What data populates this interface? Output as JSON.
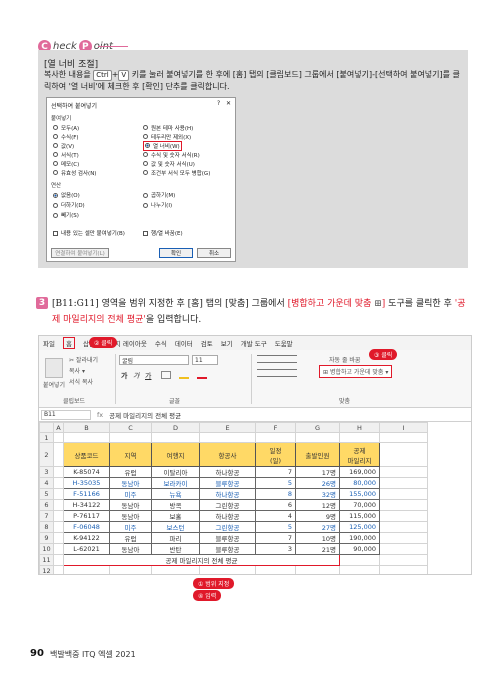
{
  "checkpoint": {
    "c": "C",
    "heck": "heck",
    "p": "P",
    "oint": "oint"
  },
  "box": {
    "title": "[열 너비 조절]",
    "text_1": "복사한 내용을 ",
    "key_ctrl": "Ctrl",
    "plus": "+",
    "key_v": "V",
    "text_2": " 키를 눌러 붙여넣기를 한 후에 [홈] 탭의 [클립보드] 그룹에서 [붙여넣기]-[선택하여 붙여넣기]를 클릭하여 '열 너비'에 체크한 후 [확인] 단추를 클릭합니다."
  },
  "dialog": {
    "title": "선택하여 붙여넣기",
    "help": "?",
    "close": "✕",
    "paste_label": "붙여넣기",
    "paste_left": [
      "모두(A)",
      "수식(F)",
      "값(V)",
      "서식(T)",
      "메모(C)",
      "유효성 검사(N)"
    ],
    "paste_right": [
      "원본 테마 사용(H)",
      "테두리만 제외(X)",
      "열 너비(W)",
      "수식 및 숫자 서식(R)",
      "값 및 숫자 서식(U)",
      "조건부 서식 모두 병합(G)"
    ],
    "op_label": "연산",
    "op_left": [
      "없음(O)",
      "더하기(D)",
      "빼기(S)"
    ],
    "op_right": [
      "곱하기(M)",
      "나누기(I)"
    ],
    "skip_blanks": "내용 있는 셀만 붙여넣기(B)",
    "transpose": "행/열 바꿈(E)",
    "paste_link": "연결하여 붙여넣기(L)",
    "ok": "확인",
    "cancel": "취소"
  },
  "step": {
    "num": "3",
    "text_1": "[B11:G11] 영역을 범위 지정한 후 [홈] 탭의 [맞춤] 그룹에서 ",
    "text_red": "[병합하고 가운데 맞춤",
    "icon": "⊞",
    "text_red2": "]",
    "text_2": " 도구를 클릭한 후 ",
    "text_red3": "'공제 마일리지의 전체 평균'",
    "text_3": "을 입력합니다."
  },
  "excel": {
    "menu": [
      "파일",
      "홈",
      "삽입",
      "페이지 레이아웃",
      "수식",
      "데이터",
      "검토",
      "보기",
      "개발 도구",
      "도움말"
    ],
    "callout_click2": "② 클릭",
    "callout_click3": "③ 클릭",
    "ribbon": {
      "cut": "✂ 잘라내기",
      "copy": "복사 ▾",
      "format_painter": "서식 복사",
      "paste": "붙여넣기",
      "clipboard": "클립보드",
      "font_name": "굴림",
      "font_size": "11",
      "font_group": "글꼴",
      "wrap_text": "자동 줄 바꿈",
      "merge_center": "병합하고 가운데 맞춤",
      "align_group": "맞춤",
      "bold": "가",
      "italic": "가",
      "underline": "가"
    },
    "name_box": "B11",
    "formula": "공제 마일리지의 전체 평균",
    "fx": "fx",
    "columns": [
      "A",
      "B",
      "C",
      "D",
      "E",
      "F",
      "G",
      "H",
      "I"
    ],
    "headers": [
      "상품코드",
      "지역",
      "여행지",
      "항공사",
      "일정\n(일)",
      "출발인원",
      "공제\n마일리지"
    ],
    "rows": [
      {
        "r": "3",
        "c": [
          "K-85074",
          "유럽",
          "이탈리아",
          "하나항공",
          "7",
          "17명",
          "169,000"
        ],
        "blue": false
      },
      {
        "r": "4",
        "c": [
          "H-35035",
          "동남아",
          "보라카이",
          "블루항공",
          "5",
          "26명",
          "80,000"
        ],
        "blue": true
      },
      {
        "r": "5",
        "c": [
          "F-51166",
          "미주",
          "뉴욕",
          "하나항공",
          "8",
          "32명",
          "155,000"
        ],
        "blue": true
      },
      {
        "r": "6",
        "c": [
          "H-34122",
          "동남아",
          "방콕",
          "그린항공",
          "6",
          "12명",
          "70,000"
        ],
        "blue": false
      },
      {
        "r": "7",
        "c": [
          "P-76117",
          "동남아",
          "보홀",
          "하나항공",
          "4",
          "9명",
          "115,000"
        ],
        "blue": false
      },
      {
        "r": "8",
        "c": [
          "F-06048",
          "미주",
          "보스턴",
          "그린항공",
          "5",
          "27명",
          "125,000"
        ],
        "blue": true
      },
      {
        "r": "9",
        "c": [
          "K-94122",
          "유럽",
          "파리",
          "블루항공",
          "7",
          "10명",
          "190,000"
        ],
        "blue": false
      },
      {
        "r": "10",
        "c": [
          "L-62021",
          "동남아",
          "반탄",
          "블루항공",
          "3",
          "21명",
          "90,000"
        ],
        "blue": false
      }
    ],
    "merged_text": "공제 마일리지의 전체 평균",
    "callout_range": "① 범위 지정",
    "callout_input": "④ 입력"
  },
  "footer": {
    "page": "90",
    "book": "백발백중 ITQ 엑셀 2021"
  }
}
